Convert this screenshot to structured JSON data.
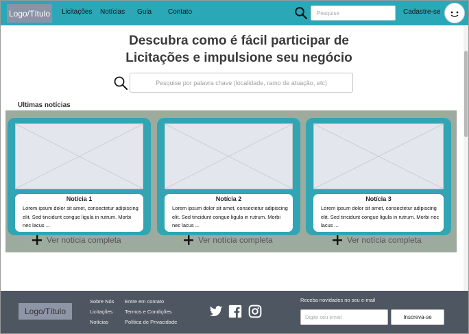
{
  "nav": {
    "logo": "Logo/Título",
    "links": [
      "Licitações",
      "Notícias",
      "Guia",
      "Contato"
    ],
    "search_placeholder": "Pesquise",
    "signup": "Cadastre-se"
  },
  "hero": {
    "title_line1": "Descubra como é fácil participar de",
    "title_line2": "Licitações e impulsione seu negócio",
    "search_placeholder": "Pesquise por palavra chave (localidade, ramo de atuação, etc)"
  },
  "news": {
    "heading": "Ultimas notícias",
    "more_label": "Ver notícia completa",
    "cards": [
      {
        "title": "Notícia 1",
        "text": "Lorem ipsum dolor sit amet, consectetur adipiscing elit. Sed tincidunt congue ligula in rutrum. Morbi nec lacus ..."
      },
      {
        "title": "Notícia 2",
        "text": "Lorem ipsum dolor sit amet, consectetur adipiscing elit. Sed tincidunt congue ligula in rutrum. Morbi nec lacus ..."
      },
      {
        "title": "Notícia 3",
        "text": "Lorem ipsum dolor sit amet, consectetur adipiscing elit. Sed tincidunt congue ligula in rutrum. Morbi nec lacus ..."
      }
    ]
  },
  "footer": {
    "logo": "Logo/Título",
    "col1": [
      "Sobre Nós",
      "Licitações",
      "Notícias"
    ],
    "col2": [
      "Entre em contato",
      "Termos e Condições",
      "Política de Privacidade"
    ],
    "social_icons": [
      "twitter-icon",
      "facebook-icon",
      "instagram-icon"
    ],
    "newsletter_label": "Receba novidades no seu e-mail",
    "newsletter_placeholder": "Digite seu email",
    "subscribe_label": "Inscreva-se"
  },
  "colors": {
    "navbar": "#2aa8b8",
    "card": "#31a5b4",
    "news_background": "#9daa9e",
    "footer": "#4e5661"
  }
}
